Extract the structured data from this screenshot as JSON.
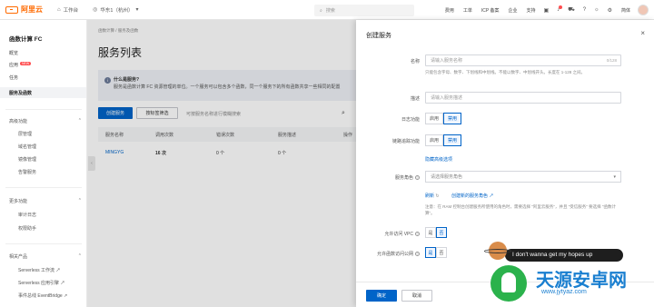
{
  "topbar": {
    "logo": "阿里云",
    "workbench": "工作台",
    "region": "华东1（杭州）",
    "search_placeholder": "搜索",
    "links": [
      "费用",
      "工单",
      "ICP 备案",
      "企业",
      "支持"
    ],
    "lang": "简体"
  },
  "sidebar": {
    "title": "函数计算 FC",
    "items": [
      "概览",
      "应用",
      "任务",
      "服务及函数"
    ],
    "new_badge": "NEW",
    "advanced_group": "高级功能",
    "advanced_items": [
      "层管理",
      "域名管理",
      "镜像管理",
      "告警服务"
    ],
    "more_group": "更多功能",
    "more_items": [
      "审计日志",
      "权限助手"
    ],
    "related_group": "相关产品",
    "related_items": [
      "Serverless 工作流",
      "Serverless 应用引擎",
      "事件总线 EventBridge"
    ]
  },
  "main": {
    "breadcrumb": "函数计算 / 服务及函数",
    "title": "服务列表",
    "info_title": "什么是服务?",
    "info_text": "服务是函数计算 FC 资源管理的单位。一个服务可以包含多个函数，同一个服务下的所有函数共享一些相同的配置",
    "create_btn": "创建服务",
    "tags_btn": "按标签筛选",
    "filter_hint": "可按服务名称进行模糊搜索",
    "columns": [
      "服务名称",
      "调用次数",
      "错误次数",
      "服务描述",
      "操作"
    ],
    "row": {
      "name": "MINGYG",
      "calls": "16 次",
      "errors": "0 个",
      "desc": "0 个"
    }
  },
  "drawer": {
    "title": "创建服务",
    "name_label": "名称",
    "name_placeholder": "请输入服务名称",
    "name_counter": "0/128",
    "name_hint": "只能包含字母、数字、下划线和中划线。不能以数字、中划线开头。长度在 1-128 之间。",
    "desc_label": "描述",
    "desc_placeholder": "请输入服务描述",
    "log_label": "日志功能",
    "trace_label": "链路追踪功能",
    "enable": "启用",
    "disable": "禁用",
    "advanced_link": "隐藏高级选项",
    "role_label": "服务角色",
    "role_placeholder": "请选择服务角色",
    "refresh": "刷新",
    "create_role": "创建新的服务角色",
    "role_note": "注意：在 RAM 控制台创建服务所使用的角色时，需要选择 \"阿里云服务\"，并且 \"受信服务\" 要选择 \"函数计算\"。",
    "vpc_label": "允许访问 VPC",
    "internet_label": "允许函数访问公网",
    "yes": "是",
    "no": "否",
    "ok_btn": "确定",
    "cancel_btn": "取消"
  },
  "overlay_art": {
    "bubble": "I don't wanna get my hopes up",
    "watermark": "天源安卓网",
    "url": "www.jytyaz.com"
  },
  "colors": {
    "primary": "#0064c8",
    "brand": "#ff6a00"
  }
}
